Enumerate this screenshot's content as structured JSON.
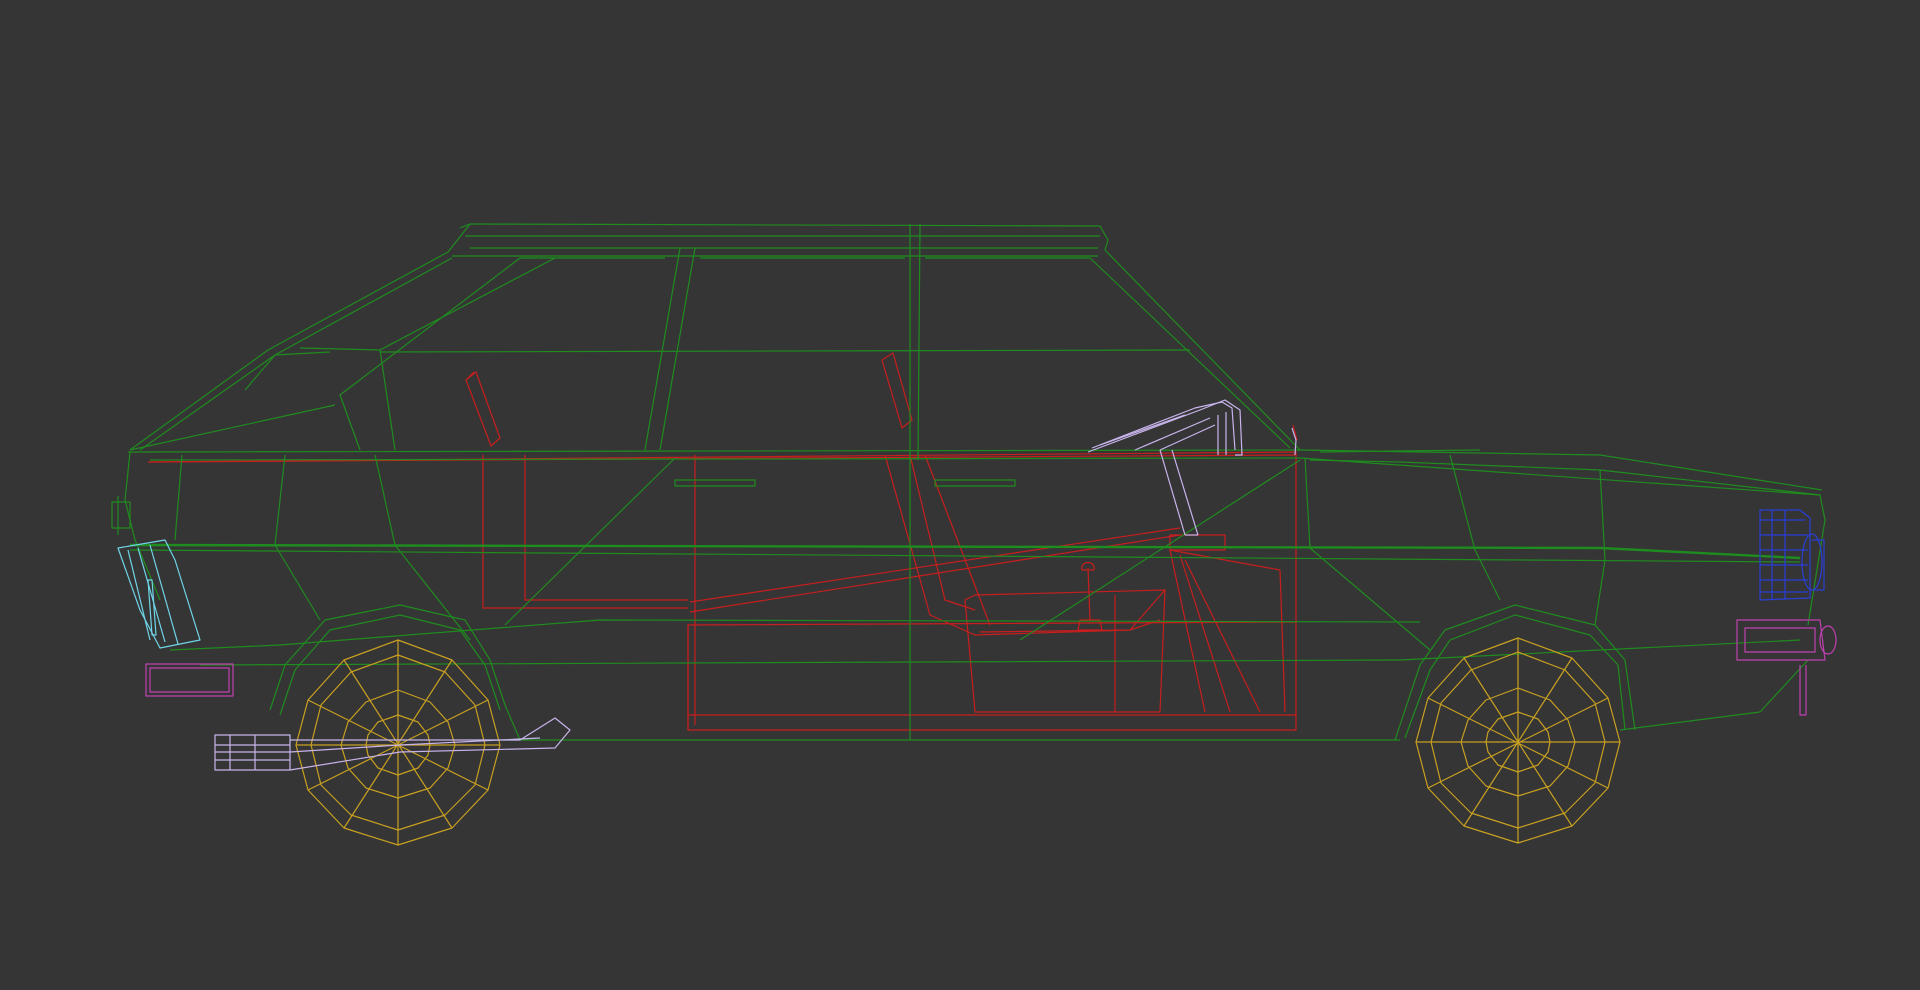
{
  "viewport": {
    "view_name": "Left",
    "shading_mode": "Wireframe",
    "background_color": "#353535"
  },
  "colors": {
    "body": "#1f8c1f",
    "interior": "#c81e1e",
    "wheels": "#c8a021",
    "chrome": "#c8b4ec",
    "lamps_front": "#2a3fd6",
    "indicator": "#6fd4e8",
    "plate": "#c040b0"
  },
  "objects": [
    {
      "id": "body",
      "label": "car-body-wireframe",
      "color_key": "body"
    },
    {
      "id": "interior",
      "label": "interior-wireframe",
      "color_key": "interior"
    },
    {
      "id": "front-wheel",
      "label": "front-wheel-wireframe",
      "color_key": "wheels"
    },
    {
      "id": "rear-wheel",
      "label": "rear-wheel-wireframe",
      "color_key": "wheels"
    },
    {
      "id": "steering",
      "label": "steering-wheel-wireframe",
      "color_key": "chrome"
    },
    {
      "id": "exhaust",
      "label": "exhaust-pipe-wireframe",
      "color_key": "chrome"
    },
    {
      "id": "headlight",
      "label": "headlight-wireframe",
      "color_key": "lamps_front"
    },
    {
      "id": "taillight",
      "label": "taillight-wireframe",
      "color_key": "indicator"
    },
    {
      "id": "front-plate",
      "label": "front-plate-wireframe",
      "color_key": "plate"
    },
    {
      "id": "rear-plate",
      "label": "rear-plate-wireframe",
      "color_key": "plate"
    }
  ]
}
